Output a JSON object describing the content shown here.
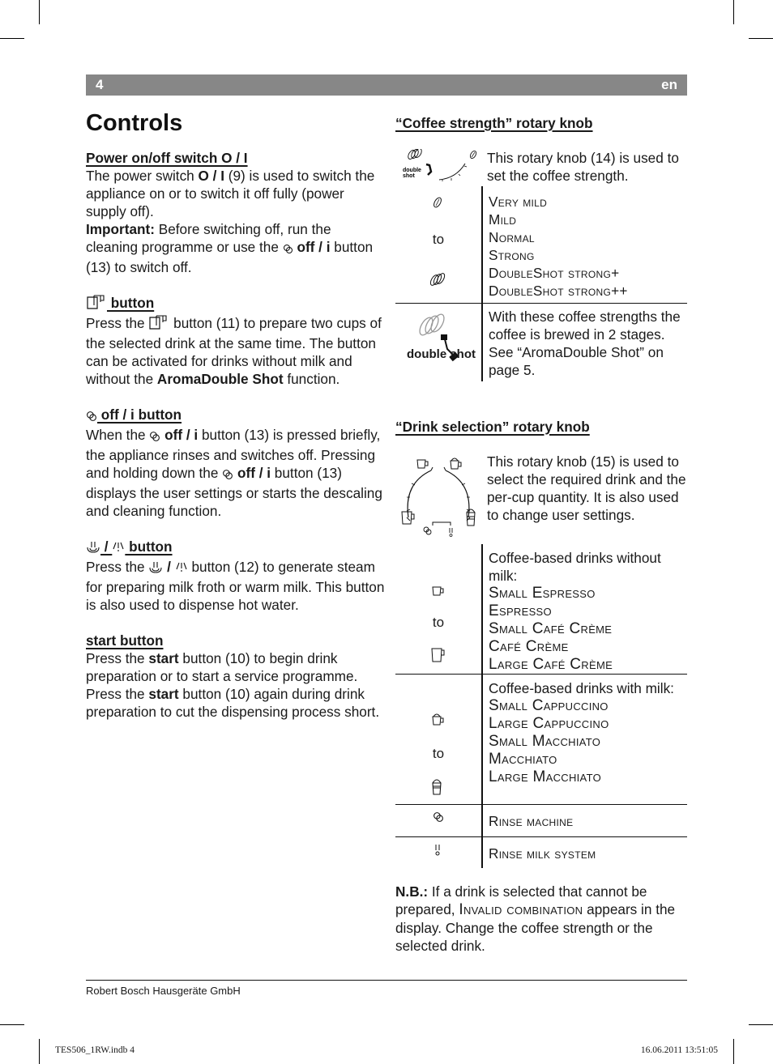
{
  "header": {
    "page_number": "4",
    "language": "en"
  },
  "title": "Controls",
  "left": {
    "power": {
      "heading": "Power on/off switch O / I",
      "p1a": "The power switch ",
      "p1b": "O / I",
      "p1c": " (9) is used to switch the appliance on or to switch it off fully (power supply off).",
      "imp_label": "Important:",
      "imp_text": " Before switching off, run the cleaning programme or use the ",
      "imp_btn": " off / i",
      "imp_end": " button (13) to switch off."
    },
    "twocup": {
      "heading": " button",
      "p_a": "Press the ",
      "p_b": " button (11) to prepare two cups of the selected drink at the same time. The button can be activated for drinks without milk and without the ",
      "p_bold": "AromaDouble Shot",
      "p_end": " function."
    },
    "off": {
      "heading": " off / i button",
      "p_a": "When the ",
      "p_b": " off / i",
      "p_c": " button (13) is pressed briefly, the appliance rinses and switches off. Pressing and holding down the ",
      "p_d": " off / i",
      "p_e": " button (13) displays the user settings or starts the descaling and cleaning function."
    },
    "steam": {
      "heading": " button",
      "p_a": "Press the ",
      "p_b": " button (12) to generate steam for preparing milk froth or warm milk. This button is also used to dispense hot water."
    },
    "start": {
      "heading": "start button",
      "p_a": "Press the ",
      "p_bold1": "start",
      "p_b": " button (10) to begin drink preparation or to start a service programme. Press the ",
      "p_bold2": "start",
      "p_c": " button (10) again during drink preparation to cut the dispensing process short."
    }
  },
  "strength": {
    "heading": "“Coffee strength” rotary knob",
    "intro": "This rotary knob (14) is used to set the coffee strength.",
    "knob_label": "double shot",
    "to": "to",
    "levels": [
      "Very mild",
      "Mild",
      "Normal",
      "Strong",
      "DoubleShot strong+",
      "DoubleShot strong++"
    ],
    "double_note": "With these coffee strengths the coffee is brewed in 2 stages. See “AromaDouble Shot” on page 5.",
    "double_label": "double shot"
  },
  "drink": {
    "heading": "“Drink selection” rotary knob",
    "intro": "This rotary knob (15) is used to select the required drink and the per-cup quantity. It is also used to change user settings.",
    "to": "to",
    "without_milk": {
      "label": "Coffee-based drinks without milk:",
      "items": [
        "Small Espresso",
        "Espresso",
        "Small Café Crème",
        "Café Crème",
        "Large Café Crème"
      ]
    },
    "with_milk": {
      "label": "Coffee-based drinks with milk:",
      "items": [
        "Small Cappuccino",
        "Large Cappuccino",
        "Small Macchiato",
        "Macchiato",
        "Large Macchiato"
      ]
    },
    "rinse_machine": "Rinse machine",
    "rinse_milk": "Rinse milk system"
  },
  "note": {
    "label": "N.B.:",
    "text_a": " If a drink is selected that cannot be prepared, ",
    "sc": "Invalid combination",
    "text_b": " appears in the display. Change the coffee strength or the selected drink."
  },
  "footer": {
    "company": "Robert Bosch Hausgeräte GmbH",
    "slug_file": "TES506_1RW.indb   4",
    "slug_date": "16.06.2011   13:51:05"
  }
}
